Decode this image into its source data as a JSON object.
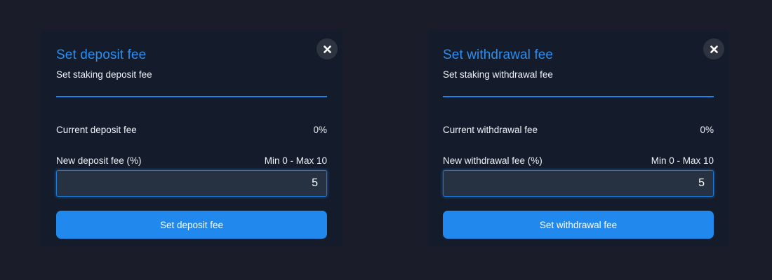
{
  "deposit_modal": {
    "title": "Set deposit fee",
    "subtitle": "Set staking deposit fee",
    "current_label": "Current deposit fee",
    "current_value": "0%",
    "new_label": "New deposit fee (%)",
    "range_label": "Min 0 - Max 10",
    "input_value": "5",
    "button_label": "Set deposit fee",
    "close_icon": "close-icon"
  },
  "withdrawal_modal": {
    "title": "Set withdrawal fee",
    "subtitle": "Set staking withdrawal fee",
    "current_label": "Current withdrawal fee",
    "current_value": "0%",
    "new_label": "New withdrawal fee (%)",
    "range_label": "Min 0 - Max 10",
    "input_value": "5",
    "button_label": "Set withdrawal fee",
    "close_icon": "close-icon"
  },
  "colors": {
    "background": "#1a1d29",
    "panel": "#141c2b",
    "accent": "#2189ed",
    "input_bg": "#263141",
    "text": "#eef1f6"
  }
}
